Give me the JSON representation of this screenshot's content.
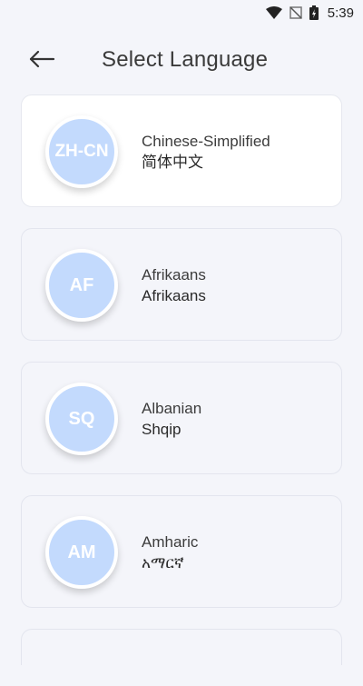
{
  "status_bar": {
    "time": "5:39",
    "icons": [
      "wifi-icon",
      "signal-off-icon",
      "battery-charging-icon"
    ]
  },
  "header": {
    "back_icon": "arrow-left-icon",
    "title": "Select Language"
  },
  "languages": [
    {
      "code": "ZH-CN",
      "name": "Chinese-Simplified",
      "native": "简体中文",
      "selected": true
    },
    {
      "code": "AF",
      "name": "Afrikaans",
      "native": "Afrikaans",
      "selected": false
    },
    {
      "code": "SQ",
      "name": "Albanian",
      "native": "Shqip",
      "selected": false
    },
    {
      "code": "AM",
      "name": "Amharic",
      "native": "አማርኛ",
      "selected": false
    }
  ],
  "colors": {
    "background": "#f4f5fa",
    "selected_card": "#ffffff",
    "badge": "#c3dafd"
  }
}
